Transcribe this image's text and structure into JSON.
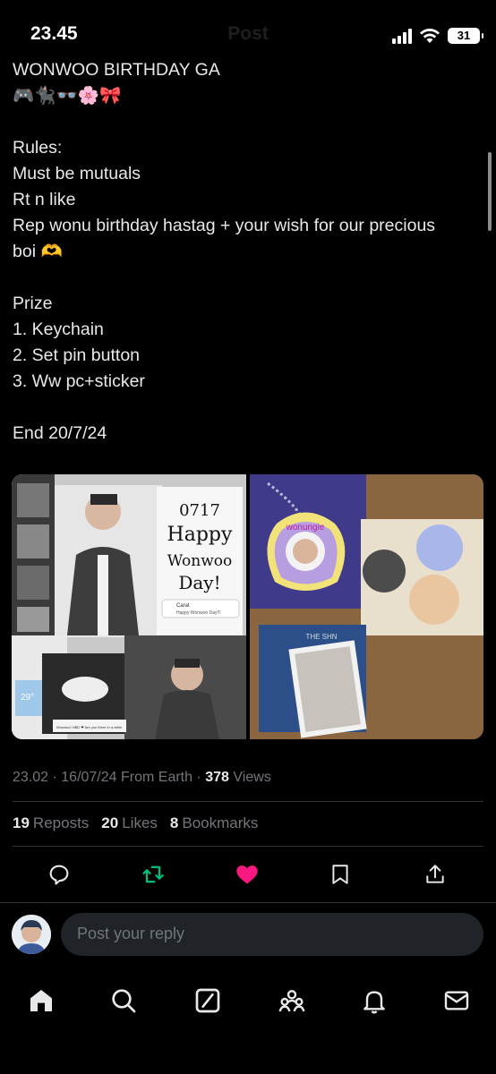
{
  "status_bar": {
    "time": "23.45",
    "title": "Post",
    "battery": "31"
  },
  "post": {
    "lines": [
      "WONWOO BIRTHDAY GA",
      "🎮🐈‍⬛👓🌸🎀",
      "",
      "Rules:",
      "Must be mutuals",
      "Rt n like",
      "Rep wonu birthday hastag + your wish for our precious",
      "boi 🫶",
      "",
      "Prize",
      "1. Keychain",
      "2. Set pin button",
      "3. Ww pc+sticker",
      "",
      "End 20/7/24"
    ]
  },
  "media": {
    "image1": {
      "card_text": [
        "0717",
        "Happy",
        "Wonwoo",
        "Day!"
      ],
      "comment_name": "Carat",
      "comment_text": "Happy Wonwoo Day!!!",
      "weather": "29°",
      "message": "Wonwoo! HBD ❤ Are you there in a while"
    },
    "image2": {
      "keychain_text": "wonungie",
      "photocard_text": "THE SHN"
    }
  },
  "meta": {
    "time": "23.02",
    "date": "16/07/24",
    "location": "From Earth",
    "views_count": "378",
    "views_label": "Views"
  },
  "stats": {
    "reposts_count": "19",
    "reposts_label": "Reposts",
    "likes_count": "20",
    "likes_label": "Likes",
    "bookmarks_count": "8",
    "bookmarks_label": "Bookmarks"
  },
  "reply": {
    "placeholder": "Post your reply"
  },
  "colors": {
    "background": "#000000",
    "text": "#e7e9ea",
    "muted": "#71767b",
    "repost": "#00ba7c",
    "like": "#f91880",
    "divider": "#2f3336"
  },
  "icons": {
    "actions": [
      "reply-icon",
      "repost-icon",
      "like-icon",
      "bookmark-icon",
      "share-icon"
    ],
    "tabs": [
      "home-icon",
      "search-icon",
      "grok-icon",
      "communities-icon",
      "notifications-icon",
      "messages-icon"
    ]
  }
}
